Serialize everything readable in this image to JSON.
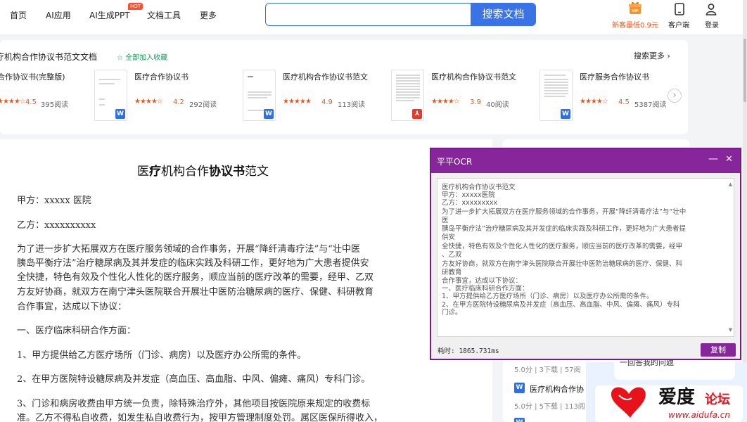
{
  "nav": {
    "items": [
      "首页",
      "AI应用",
      "AI生成PPT",
      "文档工具",
      "更多"
    ],
    "hot_badge": "HOT",
    "search_placeholder": "",
    "search_button": "搜索文档",
    "vip_badge": "VIP",
    "vip_label": "新客最低0.9元",
    "client_label": "客户端",
    "login_label": "登录",
    "accent_color": "#3a73e6"
  },
  "related": {
    "title": "疗机构合作协议书范文文档",
    "favorite": "☆ 全部加入收藏",
    "more": "搜索更多 ›",
    "cards": [
      {
        "name": "合作协议书(完整版)",
        "stars": "★★★★☆",
        "rating": "4.5",
        "reads": "395阅读",
        "filetype": "word"
      },
      {
        "name": "医疗合作协议书",
        "stars": "★★★★☆",
        "rating": "4.2",
        "reads": "292阅读",
        "filetype": "word"
      },
      {
        "name": "医疗机构合作协议书范文",
        "stars": "★★★★★",
        "rating": "4.9",
        "reads": "113阅读",
        "filetype": "word"
      },
      {
        "name": "医疗机构合作协议书范文",
        "stars": "★★★★☆",
        "rating": "3.9",
        "reads": "40阅读",
        "filetype": "pdf"
      },
      {
        "name": "医疗服务合作协议书",
        "stars": "★★★★☆",
        "rating": "4.5",
        "reads": "5387阅读",
        "filetype": "word"
      }
    ],
    "next_icon": "›"
  },
  "document": {
    "title_parts": [
      "医",
      "疗",
      "机构合作",
      "协议书",
      "范文"
    ],
    "paragraphs": [
      "甲方：xxxxx 医院",
      "乙方：xxxxxxxxxx",
      "为了进一步扩大拓展双方在医疗服务领域的合作事务，开展“降纤清毒疗法”与“壮中医",
      "胰岛平衡疗法”治疗糖尿病及其并发症的临床实践及科研工作，更好地为广大患者提供安",
      "全快捷，特色有效及个性化人性化的医疗服务，顺应当前的医疗改革的需要，经甲、乙双",
      "方友好协商，就双方在南宁津头医院联合开展壮中医防治糖尿病的医疗、保健、科研教育",
      "合作事宜，达成以下协议：",
      "一、医疗临床科研合作方面：",
      "1、甲方提供给乙方医疗场所（门诊、病房）以及医疗办公所需的条件。",
      "2、在甲方医院特设糖尿病及并发症（高血压、高血脂、中风、偏瘫、痛风）专科门诊。",
      "3、门诊和病房收费由甲方统一负责，除特殊治疗外，其他项目按医院原来规定的收费标",
      "准。乙方不得私自收费，如发生私自收费行为，按甲方管理制度处罚。属区医保所得收入，"
    ]
  },
  "sidebar": {
    "question": "一回答我的问题",
    "items": [
      {
        "meta": "5.0分 | 3下载 | 57阅"
      },
      {
        "doc": "医疗机构合作协",
        "meta": "5.0分 | 5下载 | 113阅"
      }
    ]
  },
  "ocr": {
    "title": "平平OCR",
    "minimize": "—",
    "close": "✕",
    "lines": [
      "医疗机构合作协议书范文",
      "甲方：xxxxx医院",
      "乙方：xxxxxxxxx",
      "为了进一步扩大拓展双方在医疗服务领域的合作事务，开展“降纤清毒疗法”与“壮中",
      "医",
      "胰岛平衡疗法”治疗糖尿病及其并发症的临床实践及科研工作，更好地为广大患者提",
      "供安",
      "全快捷，特色有效及个性化人性化的医疗服务，顺应当前的医疗改革的需要，经甲",
      "、乙双",
      "方友好协商，就双方在南宁津头医院联合开展壮中医防治糖尿病的医疗、保健、科",
      "研教育",
      "合作事宜，达成以下协议：",
      "一、医疗临床科研合作方面：",
      "1、甲方提供给乙方医疗场所（门诊、病房）以及医疗办公所需的条件。",
      "2、在甲方医院特设糖尿病及并发症（高血压、高血脂、中风、偏瘫、痛风）专科",
      "门诊。"
    ],
    "elapsed": "耗时: 1865.731ms",
    "copy": "复制",
    "accent_color": "#86269a"
  },
  "watermark": {
    "brand": "爱度",
    "forum": "论坛",
    "url": "www.aidufa.cn"
  }
}
